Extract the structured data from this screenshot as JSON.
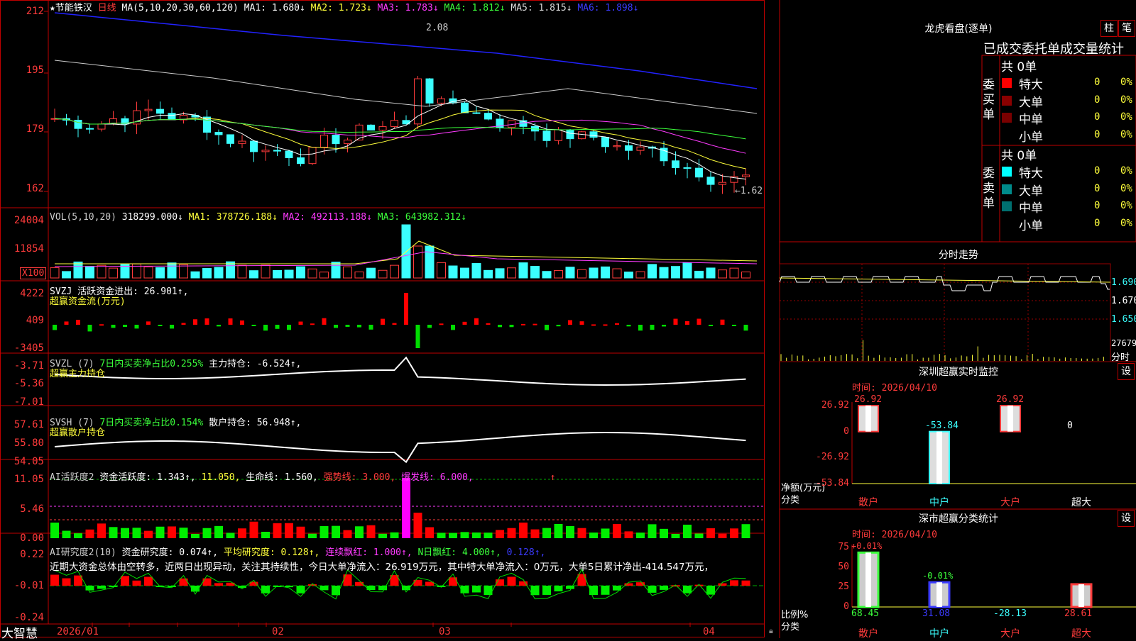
{
  "app": {
    "brand": "大智慧"
  },
  "main_chart": {
    "stock_name": "★节能铁汉",
    "period": "日线",
    "ma_header": "MA(5,10,20,30,60,120)",
    "ma": [
      {
        "label": "MA1: 1.680↓",
        "color": "#ffffff"
      },
      {
        "label": "MA2: 1.723↓",
        "color": "#ffff3b"
      },
      {
        "label": "MA3: 1.783↓",
        "color": "#ff3bff"
      },
      {
        "label": "MA4: 1.812↓",
        "color": "#3bff3b"
      },
      {
        "label": "MA5: 1.815↓",
        "color": "#dddddd"
      },
      {
        "label": "MA6: 1.898↓",
        "color": "#3b3bff"
      }
    ],
    "y_ticks": [
      "212",
      "195",
      "179",
      "162"
    ],
    "high_label": "2.08",
    "low_label": "←1.62"
  },
  "volume": {
    "header": "VOL(5,10,20)",
    "value": "318299.000↓",
    "ma1": "MA1: 378726.188↓",
    "ma2": "MA2: 492113.188↓",
    "ma3": "MA3: 643982.312↓",
    "y_ticks": [
      "24004",
      "11854",
      "X100"
    ]
  },
  "svzj": {
    "header": "SVZJ  活跃资金进出: 26.901↑,",
    "sub": "超赢资金流(万元)",
    "y_ticks": [
      "4222",
      "409",
      "-3405"
    ]
  },
  "svzl": {
    "name": "SVZL (7)",
    "green_text": "7日内买卖净占比0.255%",
    "white_text": "主力持仓: -6.524↑,",
    "sub": "超赢主力持仓",
    "y_ticks": [
      "-3.71",
      "-5.36",
      "-7.01"
    ]
  },
  "svsh": {
    "name": "SVSH (7)",
    "green_text": "7日内买卖净占比0.154%",
    "white_text": "散户持仓: 56.948↑,",
    "sub": "超赢散户持仓",
    "y_ticks": [
      "57.61",
      "55.80",
      "54.05"
    ]
  },
  "ai_active": {
    "name": "AI活跃度2",
    "t1": "资金活跃度: 1.343↑,",
    "t2": "11.050,",
    "t3": "生命线: 1.560,",
    "t4": "强势线: 3.000,",
    "t5": "爆发线: 6.000,",
    "t6": "↑",
    "y_ticks": [
      "11.05",
      "5.46",
      "0.00"
    ]
  },
  "ai_research": {
    "name": "AI研究度2(10)",
    "t1": "资金研究度: 0.074↑,",
    "t2": "平均研究度: 0.128↑,",
    "t3": "连续飘红: 1.000↑,",
    "t4": "N日飘红: 4.000↑,",
    "t5": "0.128↑,",
    "comment": "近期大资金总体由空转多，近两日出现异动，关注其持续性，今日大单净流入：26.919万元，其中特大单净流入：0万元，大单5日累计净出-414.547万元，",
    "y_ticks": [
      "0.22",
      "-0.01",
      "-0.24"
    ]
  },
  "x_axis": {
    "labels": [
      "2026/01",
      "02",
      "03",
      "04"
    ]
  },
  "lhb": {
    "title": "龙虎看盘(逐单)",
    "btn1": "柱",
    "btn2": "笔",
    "tabs": "已成交委托单成交量统计",
    "buy_label": "委买单",
    "sell_label": "委卖单",
    "buy_count": "共 0单",
    "sell_count": "共 0单",
    "buy_rows": [
      {
        "name": "特大",
        "value": "0",
        "pct": "0%",
        "color": "#ff0000"
      },
      {
        "name": "大单",
        "value": "0",
        "pct": "0%",
        "color": "#8b0000"
      },
      {
        "name": "中单",
        "value": "0",
        "pct": "0%",
        "color": "#7a0000"
      },
      {
        "name": "小单",
        "value": "0",
        "pct": "0%",
        "color": ""
      }
    ],
    "sell_rows": [
      {
        "name": "特大",
        "value": "0",
        "pct": "0%",
        "color": "#00ffff"
      },
      {
        "name": "大单",
        "value": "0",
        "pct": "0%",
        "color": "#008b8b"
      },
      {
        "name": "中单",
        "value": "0",
        "pct": "0%",
        "color": "#007070"
      },
      {
        "name": "小单",
        "value": "0",
        "pct": "0%",
        "color": ""
      }
    ]
  },
  "intraday": {
    "title": "分时走势",
    "y_ticks": [
      "1.690",
      "1.670",
      "1.650",
      "27679"
    ],
    "unit": "分时"
  },
  "sz_monitor": {
    "title": "深圳超赢实时监控",
    "btn": "设",
    "time": "时间: 2026/04/10",
    "y_ticks": [
      "26.92",
      "0",
      "-26.92",
      "-53.84"
    ],
    "ylabel": "净额(万元)",
    "xlabel": "分类",
    "categories": [
      "散户",
      "中户",
      "大户",
      "超大"
    ],
    "values": [
      26.92,
      -53.84,
      26.92,
      0
    ],
    "value_labels": [
      "26.92",
      "-53.84",
      "26.92",
      "0"
    ]
  },
  "sz_stats": {
    "title": "深市超赢分类统计",
    "btn": "设",
    "time": "时间: 2026/04/10",
    "y_ticks": [
      "75",
      "50",
      "25",
      "0"
    ],
    "ylabel": "比例%",
    "xlabel": "分类",
    "categories": [
      "散户",
      "中户",
      "大户",
      "超大"
    ],
    "top_labels": [
      "+0.01%",
      "-0.01%",
      "",
      ""
    ],
    "values": [
      68.45,
      31.08,
      -28.13,
      28.61
    ],
    "bottom_labels": [
      "68.45",
      "31.08",
      "-28.13",
      "28.61"
    ]
  }
}
